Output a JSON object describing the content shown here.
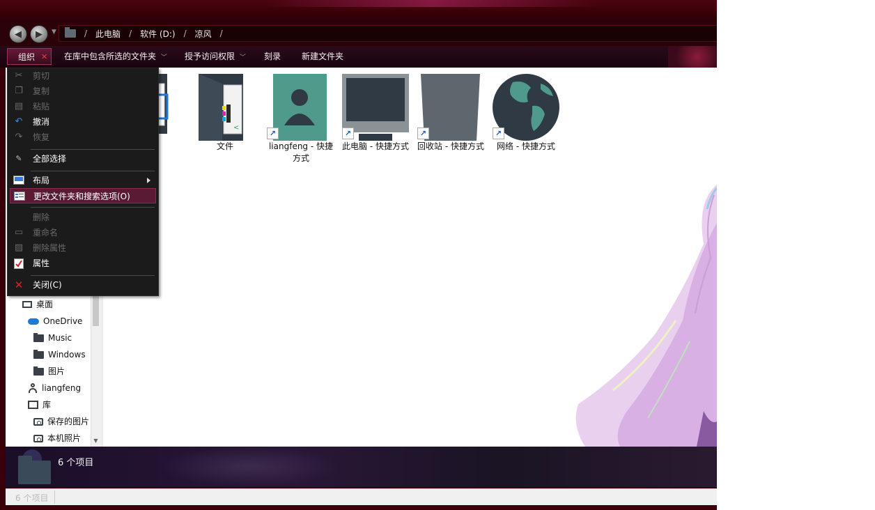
{
  "breadcrumb": [
    "此电脑",
    "软件 (D:)",
    "凉风"
  ],
  "toolbar": {
    "organize": "组织",
    "include_in_library": "在库中包含所选的文件夹",
    "grant_access": "授予访问权限",
    "burn": "刻录",
    "new_folder": "新建文件夹"
  },
  "menu": {
    "cut": "剪切",
    "copy": "复制",
    "paste": "粘贴",
    "undo": "撤消",
    "redo": "恢复",
    "select_all": "全部选择",
    "layout": "布局",
    "folder_options": "更改文件夹和搜索选项(O)",
    "delete": "删除",
    "rename": "重命名",
    "remove_properties": "删除属性",
    "properties": "属性",
    "close": "关闭(C)"
  },
  "files": [
    {
      "label": "",
      "kind": "folder-image"
    },
    {
      "label": "文件",
      "kind": "folder"
    },
    {
      "label": "liangfeng - 快捷方式",
      "kind": "user-shortcut"
    },
    {
      "label": "此电脑 - 快捷方式",
      "kind": "pc-shortcut"
    },
    {
      "label": "回收站 - 快捷方式",
      "kind": "bin-shortcut"
    },
    {
      "label": "网络 - 快捷方式",
      "kind": "globe-shortcut"
    }
  ],
  "nav": {
    "desktop": "桌面",
    "onedrive": "OneDrive",
    "music": "Music",
    "windows": "Windows",
    "pictures": "图片",
    "user": "liangfeng",
    "library": "库",
    "saved_pictures": "保存的图片",
    "camera_roll": "本机照片"
  },
  "details_pane": {
    "count": "6 个项目"
  },
  "statusbar": {
    "count": "6 个项目"
  },
  "colors": {
    "accent": "#5a1a34",
    "frame": "#3a000a",
    "shortcut_arrow": "#1a5fb4"
  }
}
